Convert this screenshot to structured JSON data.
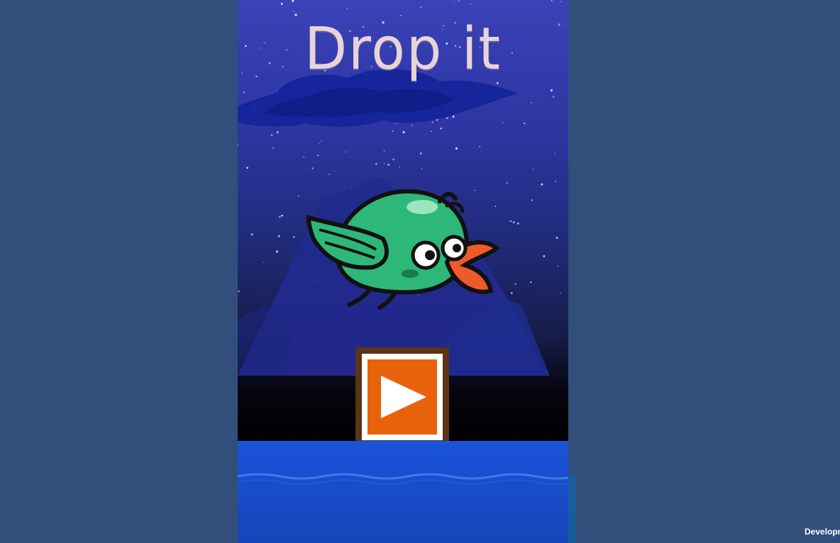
{
  "game": {
    "title": "Drop it",
    "play_button_label": "",
    "icons": {
      "play": "play-triangle-icon",
      "character": "green-bird"
    }
  },
  "overlay": {
    "development_label": "Development Build"
  },
  "colors": {
    "background": "#314f7a",
    "sky_top": "#3a42b8",
    "title": "#e8d4d8",
    "play_button_face": "#e8620c",
    "play_button_frame": "#5a3414",
    "water": "#1a54d8",
    "bird_body": "#2db87a",
    "bird_beak": "#ee5a2a"
  }
}
